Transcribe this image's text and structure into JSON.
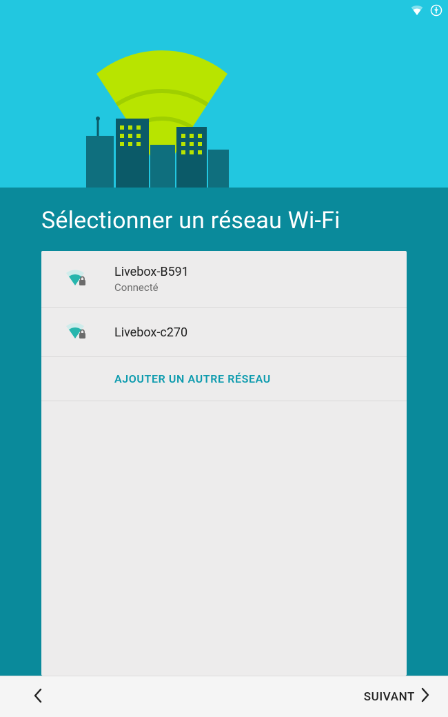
{
  "title": "Sélectionner un réseau Wi-Fi",
  "networks": [
    {
      "ssid": "Livebox-B591",
      "status": "Connecté",
      "signal": "strong",
      "secured": true
    },
    {
      "ssid": "Livebox-c270",
      "status": "",
      "signal": "strong",
      "secured": true
    }
  ],
  "add_network_label": "AJOUTER UN AUTRE RÉSEAU",
  "footer": {
    "next_label": "SUIVANT"
  },
  "colors": {
    "hero_bg": "#22c7e0",
    "body_bg": "#0a8a9b",
    "accent": "#0d9bae",
    "beam": "#b8e400"
  }
}
